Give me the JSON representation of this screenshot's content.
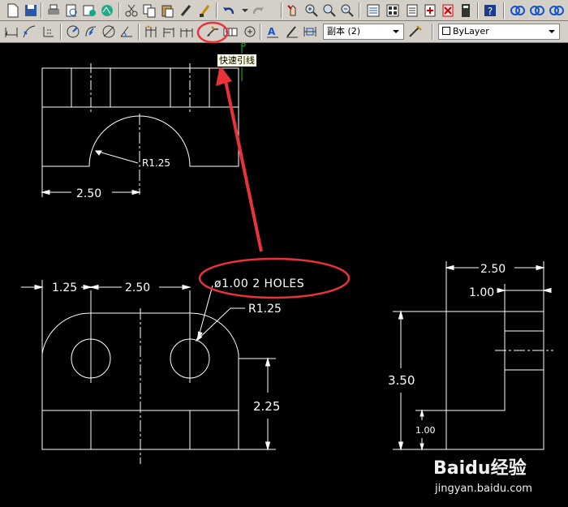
{
  "toolbar": {
    "linestyle_combo": "副本 (2)",
    "layer_combo": "ByLayer"
  },
  "tooltip": "快速引线",
  "drawing": {
    "top_view": {
      "radius_label": "R1.25",
      "width_dim": "2.50"
    },
    "front_view": {
      "dim_left": "1.25",
      "dim_mid": "2.50",
      "holes_note": "ø1.00 2 HOLES",
      "radius_label": "R1.25",
      "height_dim": "2.25"
    },
    "side_view": {
      "dim_top": "2.50",
      "dim_second": "1.00",
      "height_dim": "3.50",
      "small_dim": "1.00"
    }
  },
  "watermark": {
    "brand": "Baidu经验",
    "url": "jingyan.baidu.com"
  },
  "colors": {
    "annotation": "#e8333a",
    "drawing": "#ffffff",
    "background": "#000000"
  }
}
